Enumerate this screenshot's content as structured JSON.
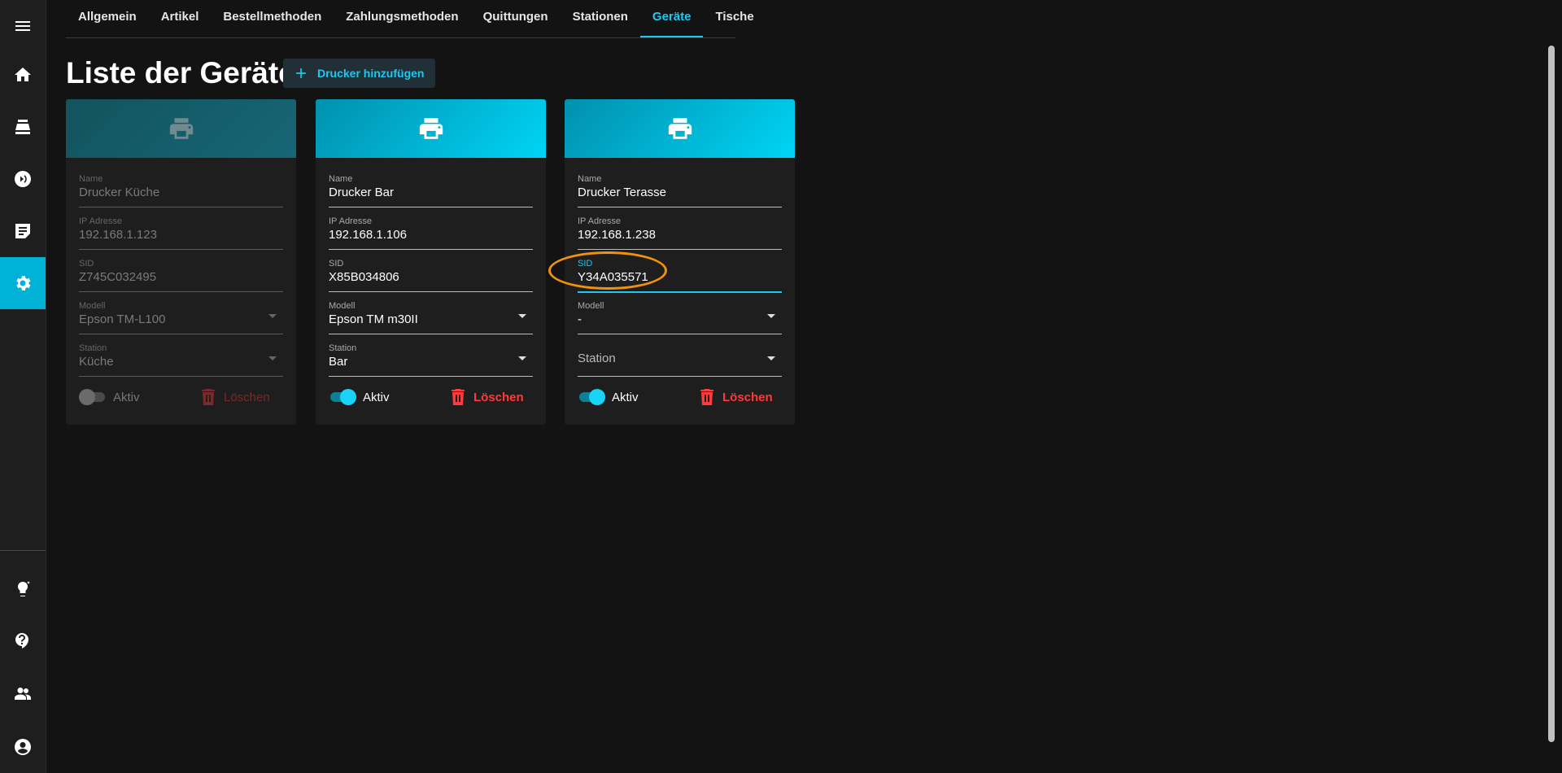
{
  "tabs": [
    "Allgemein",
    "Artikel",
    "Bestellmethoden",
    "Zahlungsmethoden",
    "Quittungen",
    "Stationen",
    "Geräte",
    "Tische"
  ],
  "active_tab": "Geräte",
  "page": {
    "title": "Liste der Geräte",
    "add_button": "Drucker hinzufügen"
  },
  "sidebar": {
    "items": [
      "menu-icon",
      "home-icon",
      "cash-register-icon",
      "payment-icon",
      "order-list-icon",
      "settings-icon",
      "lightbulb-icon",
      "help-icon",
      "users-icon",
      "account-icon"
    ],
    "active": "settings-icon"
  },
  "labels": {
    "name": "Name",
    "ip": "IP Adresse",
    "sid": "SID",
    "model": "Modell",
    "station": "Station",
    "active": "Aktiv",
    "delete": "Löschen"
  },
  "printers": [
    {
      "name": "Drucker Küche",
      "ip": "192.168.1.123",
      "sid": "Z745C032495",
      "model": "Epson TM-L100",
      "station": "Küche",
      "active": false
    },
    {
      "name": "Drucker Bar",
      "ip": "192.168.1.106",
      "sid": "X85B034806",
      "model": "Epson TM m30II",
      "station": "Bar",
      "active": true
    },
    {
      "name": "Drucker Terasse",
      "ip": "192.168.1.238",
      "sid": "Y34A035571",
      "model": "-",
      "station": "",
      "active": true
    }
  ],
  "colors": {
    "accent": "#1ec8f0",
    "danger": "#ff3a3a",
    "highlight": "#f0920c",
    "sidebar_active": "#00b3d6"
  }
}
